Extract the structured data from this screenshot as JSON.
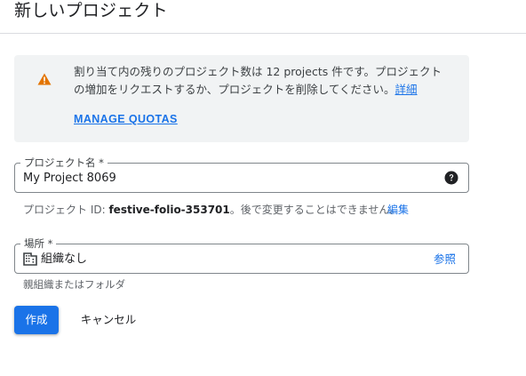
{
  "header": {
    "title": "新しいプロジェクト"
  },
  "quota_notice": {
    "icon": "warning-icon",
    "icon_color": "#e37400",
    "message": "割り当て内の残りのプロジェクト数は 12 projects 件です。プロジェクトの増加をリクエストするか、プロジェクトを削除してください。",
    "details_link": "詳細",
    "manage_link": "MANAGE QUOTAS"
  },
  "project_name": {
    "label": "プロジェクト名 *",
    "value": "My Project 8069",
    "help_icon": "help-icon"
  },
  "project_id": {
    "prefix": "プロジェクト ID: ",
    "value": "festive-folio-353701",
    "suffix": "。後で変更することはできません。",
    "edit_label": "編集"
  },
  "location": {
    "label": "場所 *",
    "icon": "building-icon",
    "value": "組織なし",
    "browse_label": "参照",
    "hint": "親組織またはフォルダ"
  },
  "actions": {
    "create_label": "作成",
    "cancel_label": "キャンセル"
  },
  "colors": {
    "accent": "#1a73e8",
    "notice_bg": "#f1f3f4",
    "warning": "#e37400"
  }
}
